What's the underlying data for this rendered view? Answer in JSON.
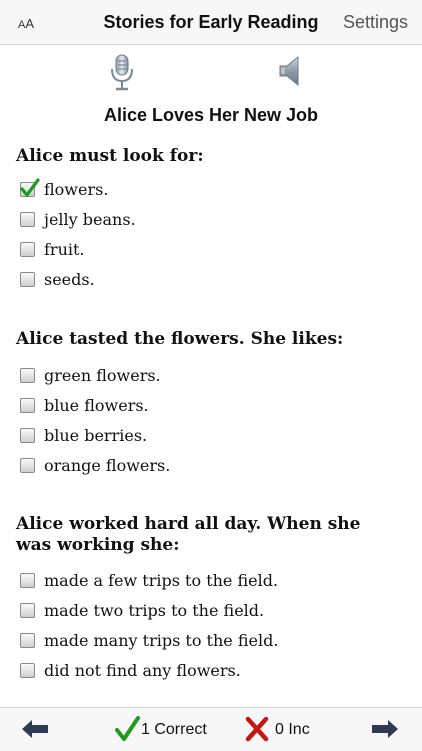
{
  "navbar": {
    "font_size_label_small": "A",
    "font_size_label_big": "A",
    "title": "Stories for Early Reading",
    "settings_label": "Settings"
  },
  "icons": {
    "microphone": "microphone-icon",
    "speaker": "speaker-icon",
    "back": "arrow-left-icon",
    "forward": "arrow-right-icon",
    "correct": "checkmark-icon",
    "incorrect": "x-mark-icon"
  },
  "story_title": "Alice Loves Her New Job",
  "questions": [
    {
      "prompt": "Alice must look for:",
      "options": [
        {
          "text": "flowers.",
          "checked": true
        },
        {
          "text": "jelly beans.",
          "checked": false
        },
        {
          "text": "fruit.",
          "checked": false
        },
        {
          "text": "seeds.",
          "checked": false
        }
      ]
    },
    {
      "prompt": "Alice tasted the flowers. She likes:",
      "options": [
        {
          "text": "green flowers.",
          "checked": false
        },
        {
          "text": "blue flowers.",
          "checked": false
        },
        {
          "text": "blue berries.",
          "checked": false
        },
        {
          "text": "orange flowers.",
          "checked": false
        }
      ]
    },
    {
      "prompt": "Alice worked hard all day. When she was working she:",
      "options": [
        {
          "text": "made a few trips to the field.",
          "checked": false
        },
        {
          "text": "made two trips to the field.",
          "checked": false
        },
        {
          "text": "made many trips to the field.",
          "checked": false
        },
        {
          "text": "did not find any flowers.",
          "checked": false
        }
      ]
    }
  ],
  "footer": {
    "correct_label": "1 Correct",
    "incorrect_label": "0 Inc"
  },
  "colors": {
    "check_green": "#1e9a1e",
    "x_red": "#c41616",
    "arrow_navy": "#2f3b55",
    "bar_bg": "#f7f7f8"
  }
}
